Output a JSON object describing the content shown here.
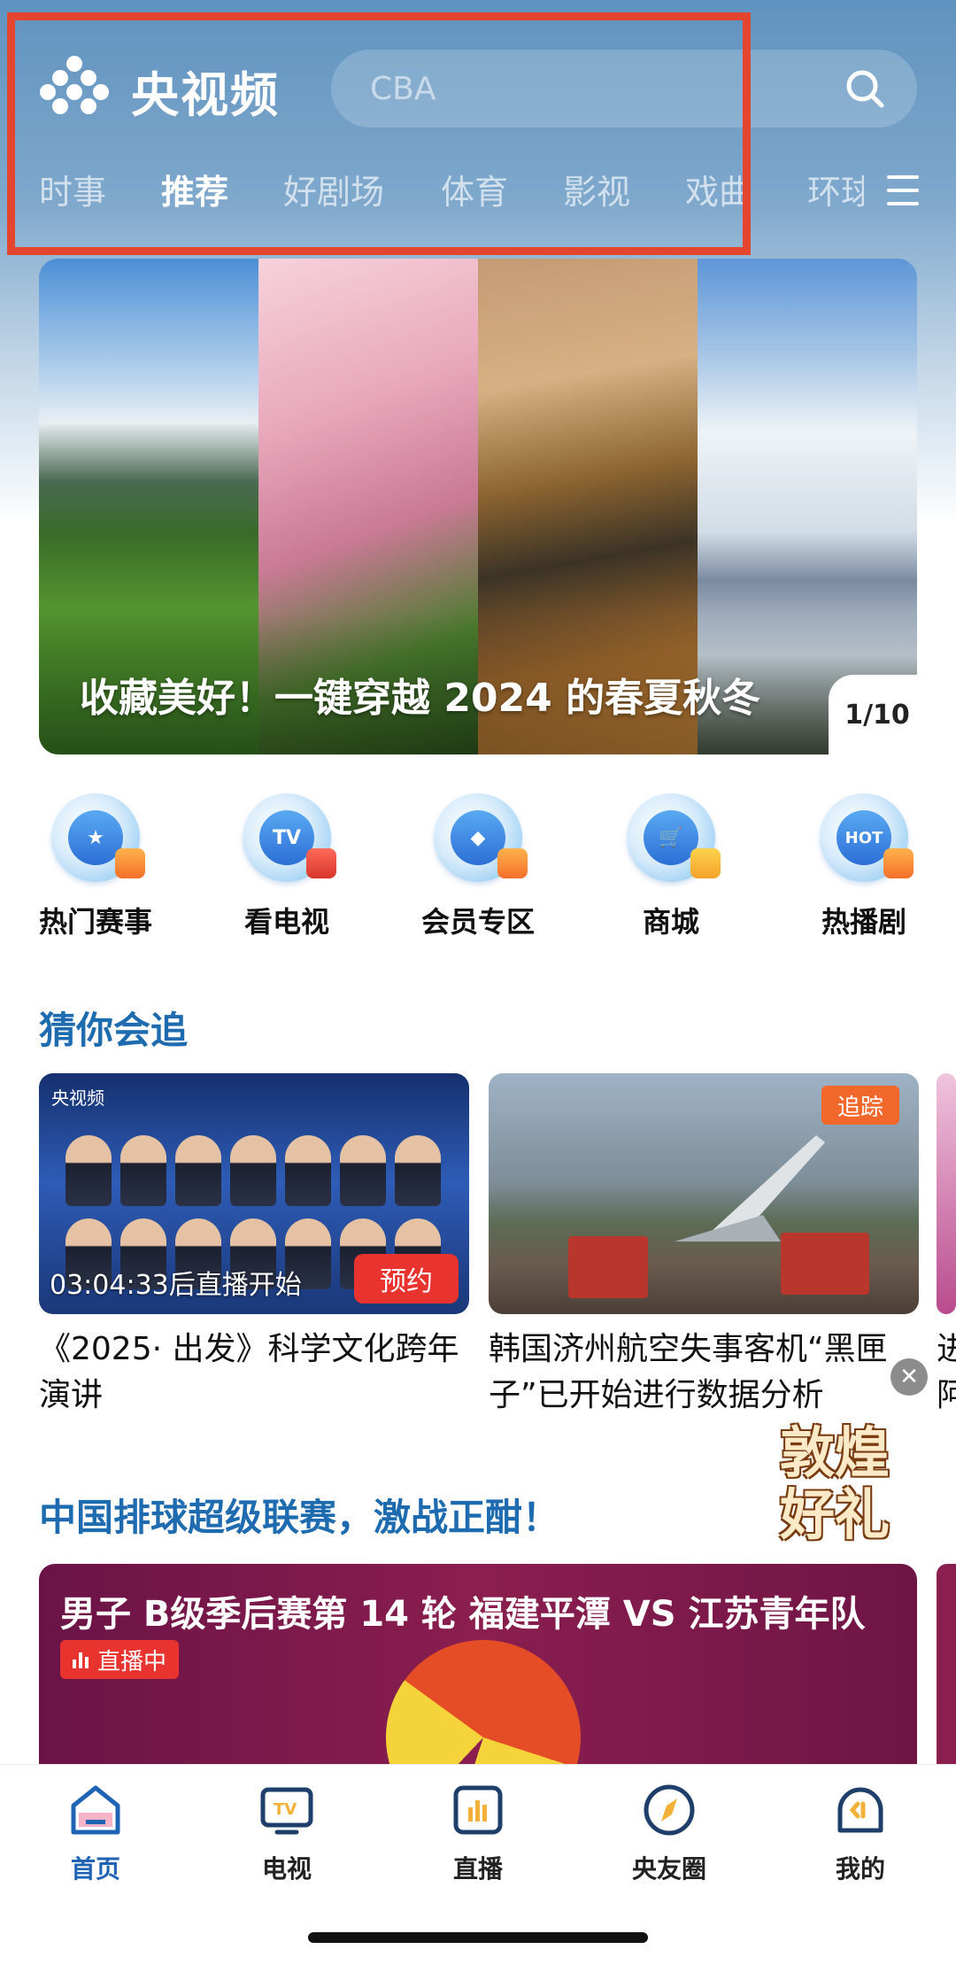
{
  "header": {
    "app_name": "央视频",
    "search_placeholder": "CBA"
  },
  "tabs": [
    {
      "label": "时事",
      "active": false
    },
    {
      "label": "推荐",
      "active": true
    },
    {
      "label": "好剧场",
      "active": false
    },
    {
      "label": "体育",
      "active": false
    },
    {
      "label": "影视",
      "active": false
    },
    {
      "label": "戏曲",
      "active": false
    },
    {
      "label": "环球",
      "active": false
    }
  ],
  "banner": {
    "title": "收藏美好！一键穿越 2024 的春夏秋冬",
    "counter": "1/10"
  },
  "quick_entries": [
    {
      "label": "热门赛事",
      "icon": "trophy-icon"
    },
    {
      "label": "看电视",
      "icon": "tv-icon",
      "glyph": "TV"
    },
    {
      "label": "会员专区",
      "icon": "vip-icon"
    },
    {
      "label": "商城",
      "icon": "cart-icon"
    },
    {
      "label": "热播剧",
      "icon": "hot-icon",
      "glyph": "HOT"
    }
  ],
  "guess_section": {
    "title": "猜你会追",
    "cards": [
      {
        "brand": "央视频",
        "countdown": "03:04:33后直播开始",
        "action": "预约",
        "title": "《2025· 出发》科学文化跨年演讲"
      },
      {
        "tag": "追踪",
        "title": "韩国济州航空失事客机“黑匣子”已开始进行数据分析"
      },
      {
        "title": "进阿"
      }
    ]
  },
  "promo": {
    "line1": "敦煌",
    "line2": "好礼"
  },
  "volleyball_section": {
    "title": "中国排球超级联赛，激战正酣！",
    "card_title": "男子 B级季后赛第 14 轮 福建平潭 VS 江苏青年队",
    "status": "直播中"
  },
  "bottom_nav": [
    {
      "label": "首页",
      "icon": "home-icon",
      "active": true
    },
    {
      "label": "电视",
      "icon": "tv-icon",
      "active": false
    },
    {
      "label": "直播",
      "icon": "live-icon",
      "active": false
    },
    {
      "label": "央友圈",
      "icon": "compass-icon",
      "active": false
    },
    {
      "label": "我的",
      "icon": "profile-icon",
      "active": false
    }
  ],
  "colors": {
    "accent": "#1f63b5",
    "section_title": "#1e6bb0",
    "highlight_box": "#e4452f",
    "live_red": "#e8332f",
    "track_orange": "#f2672a"
  }
}
